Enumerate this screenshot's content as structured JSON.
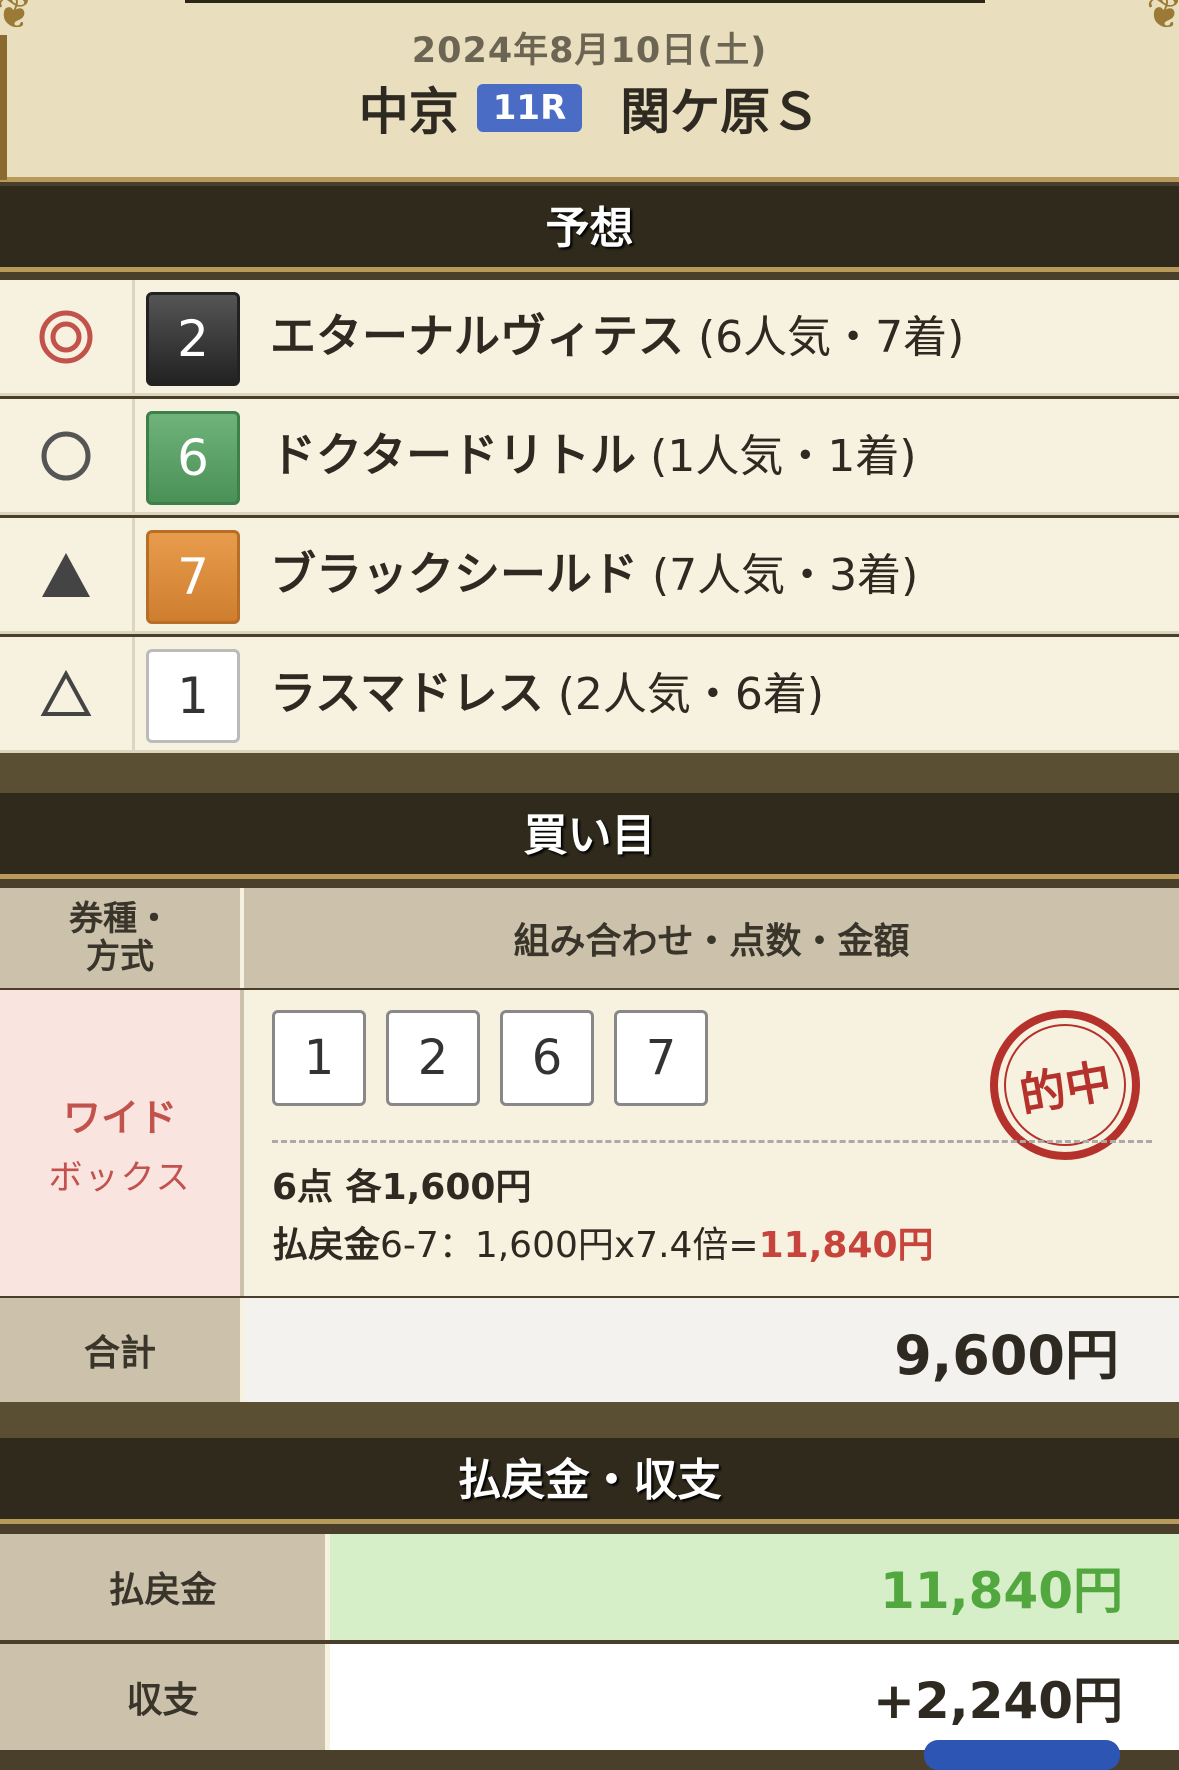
{
  "header": {
    "date": "2024年8月10日(土)",
    "venue": "中京",
    "race_no": "11R",
    "race_name": "関ケ原Ｓ"
  },
  "prediction": {
    "title": "予想",
    "rows": [
      {
        "mark": "◎",
        "num": "2",
        "name": "エターナルヴィテス",
        "info": "(6人気・7着)",
        "color": "#3a3a3a"
      },
      {
        "mark": "○",
        "num": "6",
        "name": "ドクタードリトル",
        "info": "(1人気・1着)",
        "color": "#5aa063"
      },
      {
        "mark": "▲",
        "num": "7",
        "name": "ブラックシールド",
        "info": "(7人気・3着)",
        "color": "#d98a3a"
      },
      {
        "mark": "△",
        "num": "1",
        "name": "ラスマドレス",
        "info": "(2人気・6着)",
        "color": "#ffffff"
      }
    ]
  },
  "bets": {
    "title": "買い目",
    "col1": "券種・\n方式",
    "col2": "組み合わせ・点数・金額",
    "type": "ワイド",
    "method": "ボックス",
    "numbers": [
      "1",
      "2",
      "6",
      "7"
    ],
    "stamp": "的中",
    "points": "6点 各1,600円",
    "payout_label": "払戻金",
    "payout_detail": "6-7：1,600円x7.4倍=",
    "payout_amount": "11,840円",
    "total_label": "合計",
    "total_value": "9,600円"
  },
  "result": {
    "title": "払戻金・収支",
    "payout_label": "払戻金",
    "payout_value": "11,840円",
    "balance_label": "収支",
    "balance_value": "+2,240円"
  }
}
